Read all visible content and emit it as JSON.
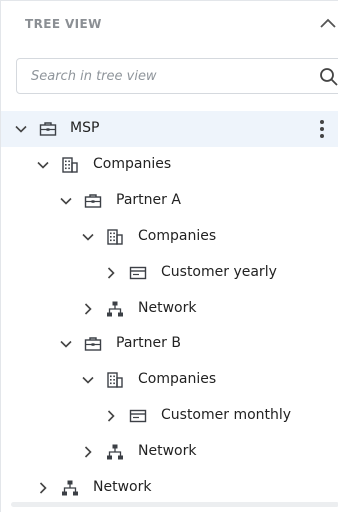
{
  "panel": {
    "title": "TREE VIEW",
    "search_placeholder": "Search in tree view"
  },
  "tree": [
    {
      "label": "MSP",
      "icon": "briefcase-icon",
      "expanded": true,
      "selected": true,
      "has_menu": true
    },
    {
      "label": "Companies",
      "icon": "building-icon",
      "expanded": true
    },
    {
      "label": "Partner A",
      "icon": "briefcase-icon",
      "expanded": true
    },
    {
      "label": "Companies",
      "icon": "building-icon",
      "expanded": true
    },
    {
      "label": "Customer yearly",
      "icon": "card-icon",
      "expanded": false
    },
    {
      "label": "Network",
      "icon": "network-icon",
      "expanded": false
    },
    {
      "label": "Partner B",
      "icon": "briefcase-icon",
      "expanded": true
    },
    {
      "label": "Companies",
      "icon": "building-icon",
      "expanded": true
    },
    {
      "label": "Customer monthly",
      "icon": "card-icon",
      "expanded": false
    },
    {
      "label": "Network",
      "icon": "network-icon",
      "expanded": false
    },
    {
      "label": "Network",
      "icon": "network-icon",
      "expanded": false
    }
  ],
  "colors": {
    "selected_row": "#eef4fb",
    "icon": "#3c4046",
    "header_text": "#8b8f94"
  }
}
